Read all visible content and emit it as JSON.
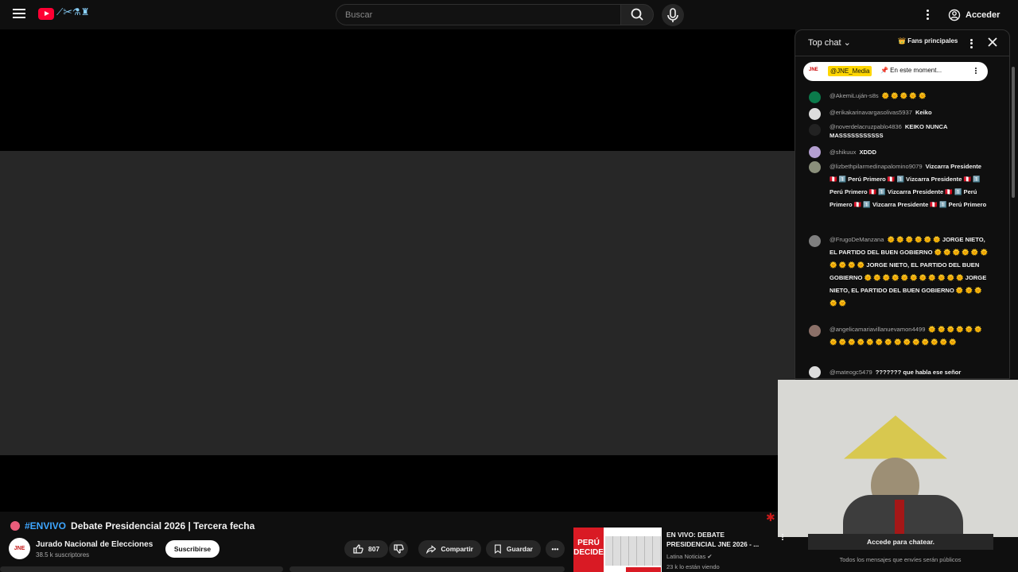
{
  "header": {
    "search_placeholder": "Buscar",
    "signin_label": "Acceder",
    "doodle_glyphs": "⟋✂⚗♜"
  },
  "video": {
    "hashtag": "#ENVIVO",
    "title": "Debate Presidencial 2026 | Tercera fecha",
    "channel": "Jurado Nacional de Elecciones",
    "subscribers": "38.5 k suscriptores",
    "subscribe_label": "Suscribirse",
    "likes": "807",
    "share_label": "Compartir",
    "save_label": "Guardar"
  },
  "chat": {
    "mode": "Top chat",
    "fans_label": "Fans principales",
    "pinned_author": "@JNE_Media",
    "pinned_text": "📌 En este moment...",
    "login_prompt": "Accede para chatear.",
    "notice": "Todos los mensajes que envíes serán públicos",
    "messages": [
      {
        "author": "@AkemiLuján-s8s",
        "text": "🌞 🌞 🌞 🌞 🌞"
      },
      {
        "author": "@erikakarinavargasolivas5937",
        "text": "Keiko"
      },
      {
        "author": "@noverdelacruzpablo4836",
        "text": "KEIKO NUNCA MASSSSSSSSSSS"
      },
      {
        "author": "@shikuux",
        "text": "XDDD"
      },
      {
        "author": "@lizbethpilarmedinapalomino9079",
        "text": "Vizcarra Presidente 🇵🇪 1️⃣ Perú Primero 🇵🇪 1️⃣ Vizcarra Presidente 🇵🇪 1️⃣ Perú Primero 🇵🇪 1️⃣ Vizcarra Presidente 🇵🇪 1️⃣ Perú Primero 🇵🇪 1️⃣ Vizcarra Presidente 🇵🇪 1️⃣ Perú Primero"
      },
      {
        "author": "@FrugoDeManzana",
        "text": "🌞 🌞 🌞 🌞 🌞 🌞 JORGE NIETO, EL PARTIDO DEL BUEN GOBIERNO 🌞 🌞 🌞 🌞 🌞 🌞 🌞 🌞 🌞 🌞 JORGE NIETO, EL PARTIDO DEL BUEN GOBIERNO 🌞 🌞 🌞 🌞 🌞 🌞 🌞 🌞 🌞 🌞 🌞 JORGE NIETO, EL PARTIDO DEL BUEN GOBIERNO 🌞 🌞 🌞 🌞 🌞"
      },
      {
        "author": "@angelicamariavillanuevamon4499",
        "text": "🌞 🌞 🌞 🌞 🌞 🌞 🌞 🌞 🌞 🌞 🌞 🌞 🌞 🌞 🌞 🌞 🌞 🌞 🌞 🌞"
      },
      {
        "author": "@mateogc5479",
        "text": "??????? que habla ese señor"
      }
    ]
  },
  "recommendation": {
    "thumb_label": "PERÚ DECIDE",
    "title": "EN VIVO: DEBATE PRESIDENCIAL JNE 2026 - ...",
    "channel": "Latina Noticias ✔",
    "views": "23 k lo están viendo"
  },
  "colors": {
    "background": "#0f0f0f",
    "accent": "#3ea6ff",
    "live": "#e95d7b",
    "youtube_red": "#ff0033"
  }
}
